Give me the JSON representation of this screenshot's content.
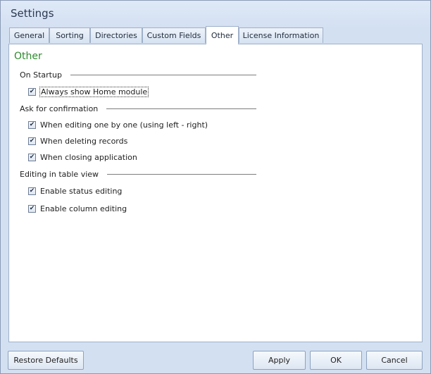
{
  "window": {
    "title": "Settings"
  },
  "tabs": [
    {
      "label": "General"
    },
    {
      "label": "Sorting"
    },
    {
      "label": "Directories"
    },
    {
      "label": "Custom Fields"
    },
    {
      "label": "Other",
      "active": true
    },
    {
      "label": "License Information"
    }
  ],
  "panel": {
    "title": "Other",
    "groups": [
      {
        "label": "On Startup",
        "options": [
          {
            "label": "Always show Home module",
            "checked": true
          }
        ]
      },
      {
        "label": "Ask for confirmation",
        "options": [
          {
            "label": "When editing one by one (using left - right)",
            "checked": true
          },
          {
            "label": "When deleting records",
            "checked": true
          },
          {
            "label": "When closing application",
            "checked": true
          }
        ]
      },
      {
        "label": "Editing in table view",
        "options": [
          {
            "label": "Enable status editing",
            "checked": true
          },
          {
            "label": "Enable column editing",
            "checked": true
          }
        ]
      }
    ]
  },
  "buttons": {
    "restore_defaults": "Restore Defaults",
    "apply": "Apply",
    "ok": "OK",
    "cancel": "Cancel"
  },
  "checkmark": "✔",
  "colors": {
    "accent_green": "#2e8b2e",
    "background": "#d3e0f2"
  }
}
